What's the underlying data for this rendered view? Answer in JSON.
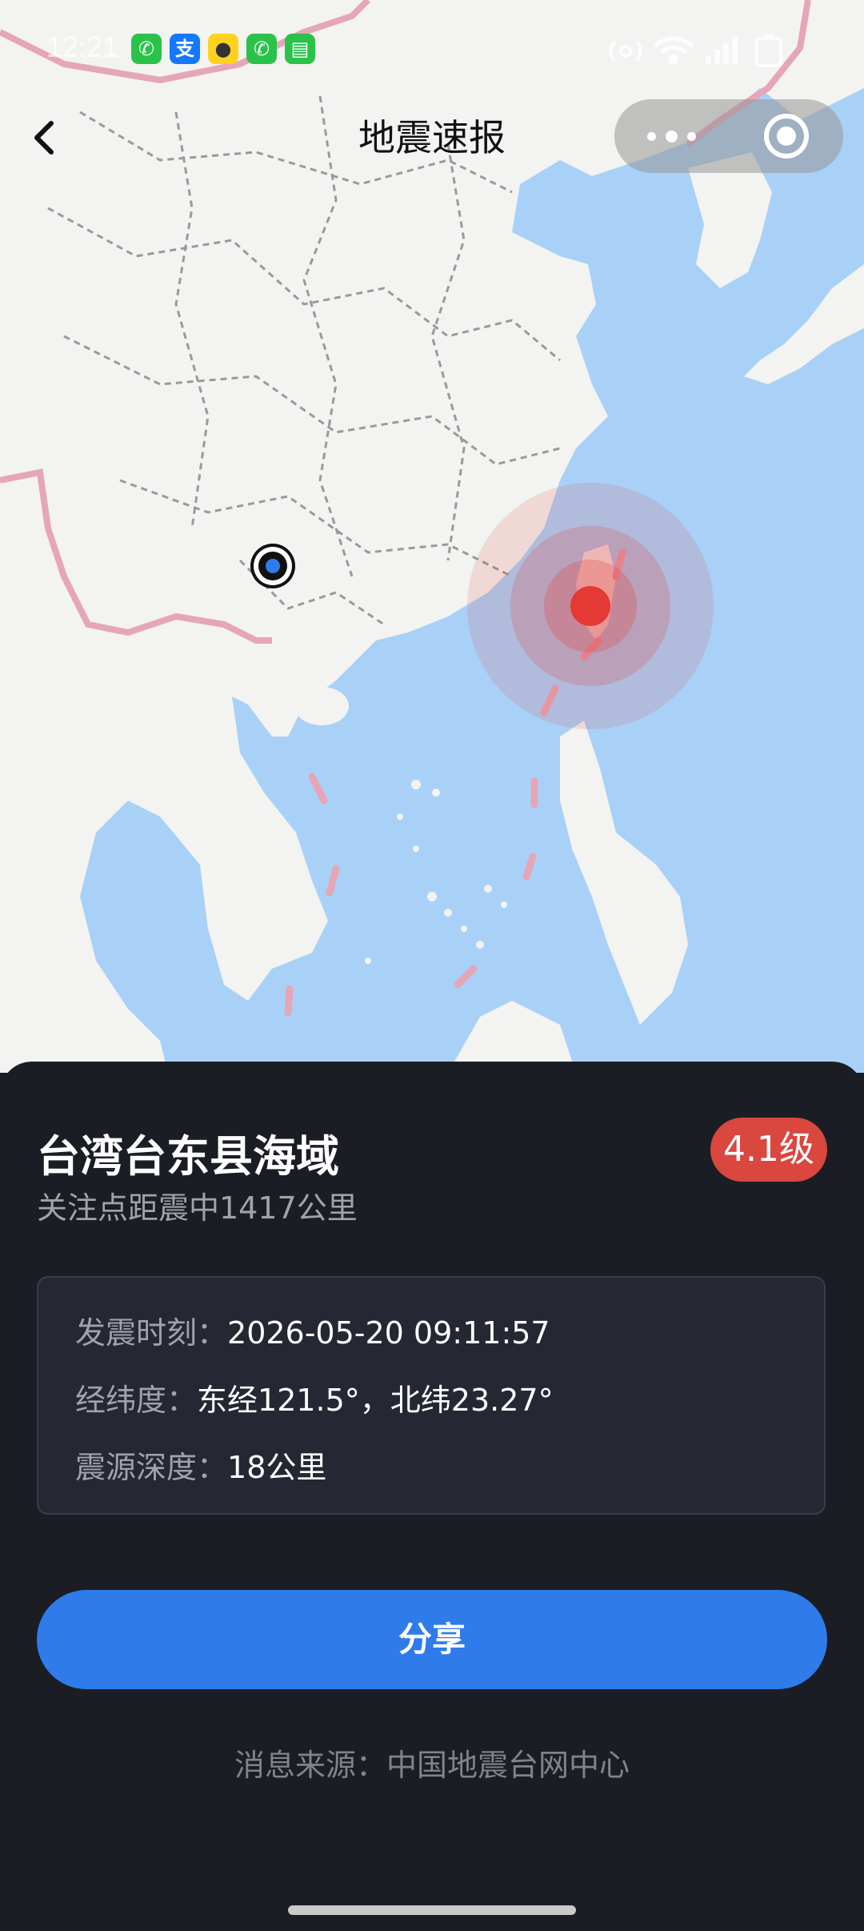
{
  "status_bar": {
    "time": "12:21",
    "app_icons": [
      {
        "name": "phone-icon",
        "color": "#2bc24a",
        "glyph": "✆"
      },
      {
        "name": "alipay-icon",
        "color": "#1677ff",
        "glyph": "支"
      },
      {
        "name": "mini-app-icon",
        "color": "#ffd21f",
        "glyph": "●"
      },
      {
        "name": "phone-icon",
        "color": "#2bc24a",
        "glyph": "✆"
      },
      {
        "name": "message-icon",
        "color": "#2bc24a",
        "glyph": "▤"
      }
    ]
  },
  "nav": {
    "title": "地震速报"
  },
  "map": {
    "user_location_color": "#2f7bea",
    "epicenter_color": "#e53935"
  },
  "event": {
    "location": "台湾台东县海域",
    "distance": "关注点距震中1417公里",
    "magnitude": "4.1级",
    "time_label": "发震时刻：",
    "time_value": "2026-05-20 09:11:57",
    "coord_label": "经纬度：",
    "coord_value": "东经121.5°，北纬23.27°",
    "depth_label": "震源深度：",
    "depth_value": "18公里"
  },
  "actions": {
    "share_label": "分享"
  },
  "footer": {
    "source": "消息来源：中国地震台网中心"
  },
  "colors": {
    "sheet_bg": "#1b1d24",
    "accent": "#2f7bea",
    "badge": "#d9473f",
    "sea": "#a9d1f7",
    "land": "#f3f3f1"
  }
}
